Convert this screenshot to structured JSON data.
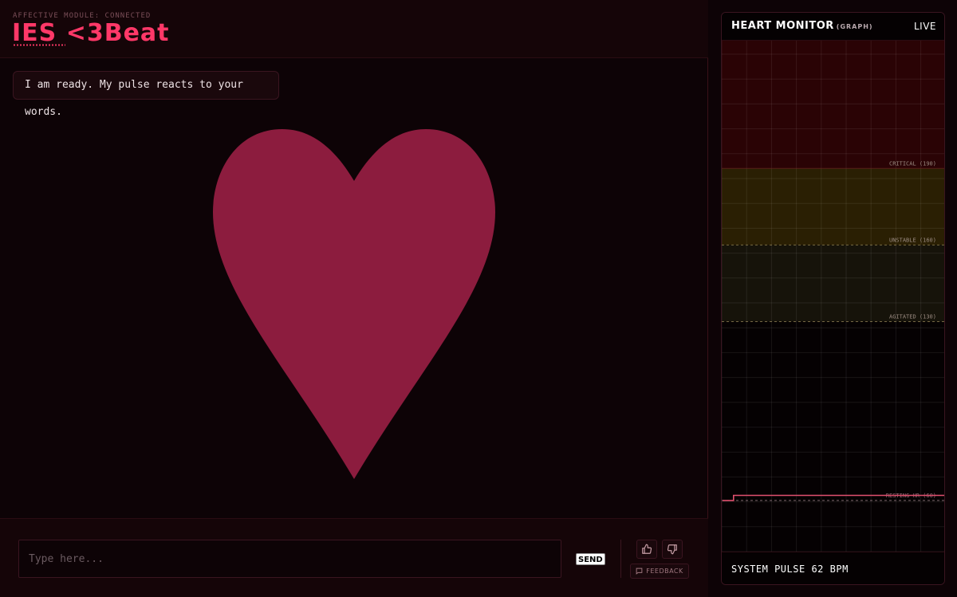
{
  "header": {
    "status": "AFFECTIVE MODULE: CONNECTED",
    "title": "IES <3Beat"
  },
  "chat": {
    "message": "I am ready. My pulse reacts to your words.",
    "input_placeholder": "Type here...",
    "send_label": "SEND",
    "feedback_label": "FEEDBACK"
  },
  "heart": {
    "color": "#8c1c3e"
  },
  "monitor": {
    "title": "HEART MONITOR",
    "subtitle": "(GRAPH)",
    "live_label": "LIVE",
    "pulse_label": "SYSTEM PULSE",
    "pulse_value": "62",
    "pulse_unit": "BPM"
  },
  "chart_data": {
    "type": "line",
    "ylim": [
      40,
      240
    ],
    "zones": [
      {
        "label": "CRITICAL (190)",
        "threshold": 190,
        "color": "#2a0305"
      },
      {
        "label": "UNSTABLE (160)",
        "threshold": 160,
        "color": "#2a1f03"
      },
      {
        "label": "AGITATED (130)",
        "threshold": 130,
        "color": "#16130a"
      }
    ],
    "reference": {
      "label": "RESTING HR (60)",
      "value": 60
    },
    "series": [
      {
        "values": [
          60,
          62,
          62,
          62,
          62,
          62,
          62,
          62,
          62,
          62,
          62,
          62,
          62,
          62,
          62,
          62,
          62,
          62,
          62,
          62
        ]
      }
    ],
    "line_color": "#e0506e",
    "grid": true
  }
}
